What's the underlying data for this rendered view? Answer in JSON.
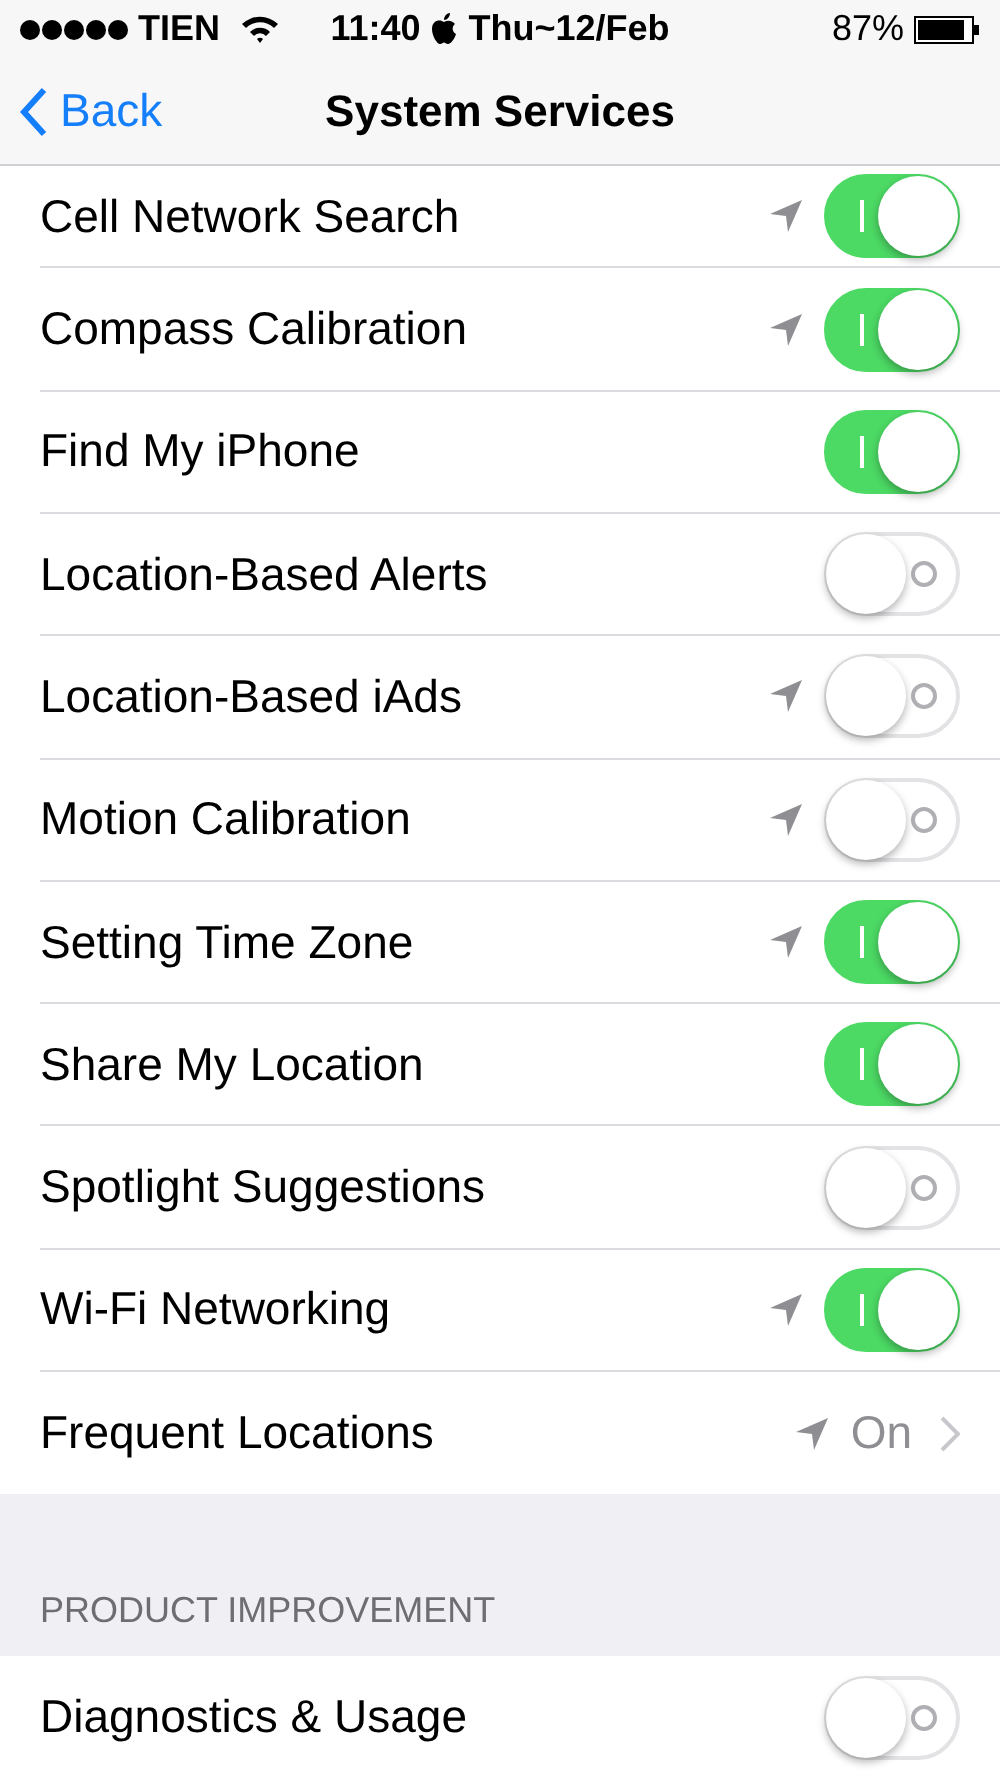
{
  "status_bar": {
    "carrier": "TIEN",
    "time": "11:40",
    "date": "Thu~12/Feb",
    "battery": "87%"
  },
  "nav": {
    "back": "Back",
    "title": "System Services"
  },
  "services": [
    {
      "name": "Cell Network Search",
      "kind": "toggle",
      "on": true,
      "location_used": true
    },
    {
      "name": "Compass Calibration",
      "kind": "toggle",
      "on": true,
      "location_used": true
    },
    {
      "name": "Find My iPhone",
      "kind": "toggle",
      "on": true,
      "location_used": false
    },
    {
      "name": "Location-Based Alerts",
      "kind": "toggle",
      "on": false,
      "location_used": false
    },
    {
      "name": "Location-Based iAds",
      "kind": "toggle",
      "on": false,
      "location_used": true
    },
    {
      "name": "Motion Calibration",
      "kind": "toggle",
      "on": false,
      "location_used": true
    },
    {
      "name": "Setting Time Zone",
      "kind": "toggle",
      "on": true,
      "location_used": true
    },
    {
      "name": "Share My Location",
      "kind": "toggle",
      "on": true,
      "location_used": false
    },
    {
      "name": "Spotlight Suggestions",
      "kind": "toggle",
      "on": false,
      "location_used": false
    },
    {
      "name": "Wi-Fi Networking",
      "kind": "toggle",
      "on": true,
      "location_used": true
    },
    {
      "name": "Frequent Locations",
      "kind": "detail",
      "value": "On",
      "location_used": true
    }
  ],
  "product_improvement": {
    "header": "PRODUCT IMPROVEMENT",
    "items": [
      {
        "name": "Diagnostics & Usage",
        "kind": "toggle",
        "on": false,
        "location_used": false
      }
    ]
  }
}
